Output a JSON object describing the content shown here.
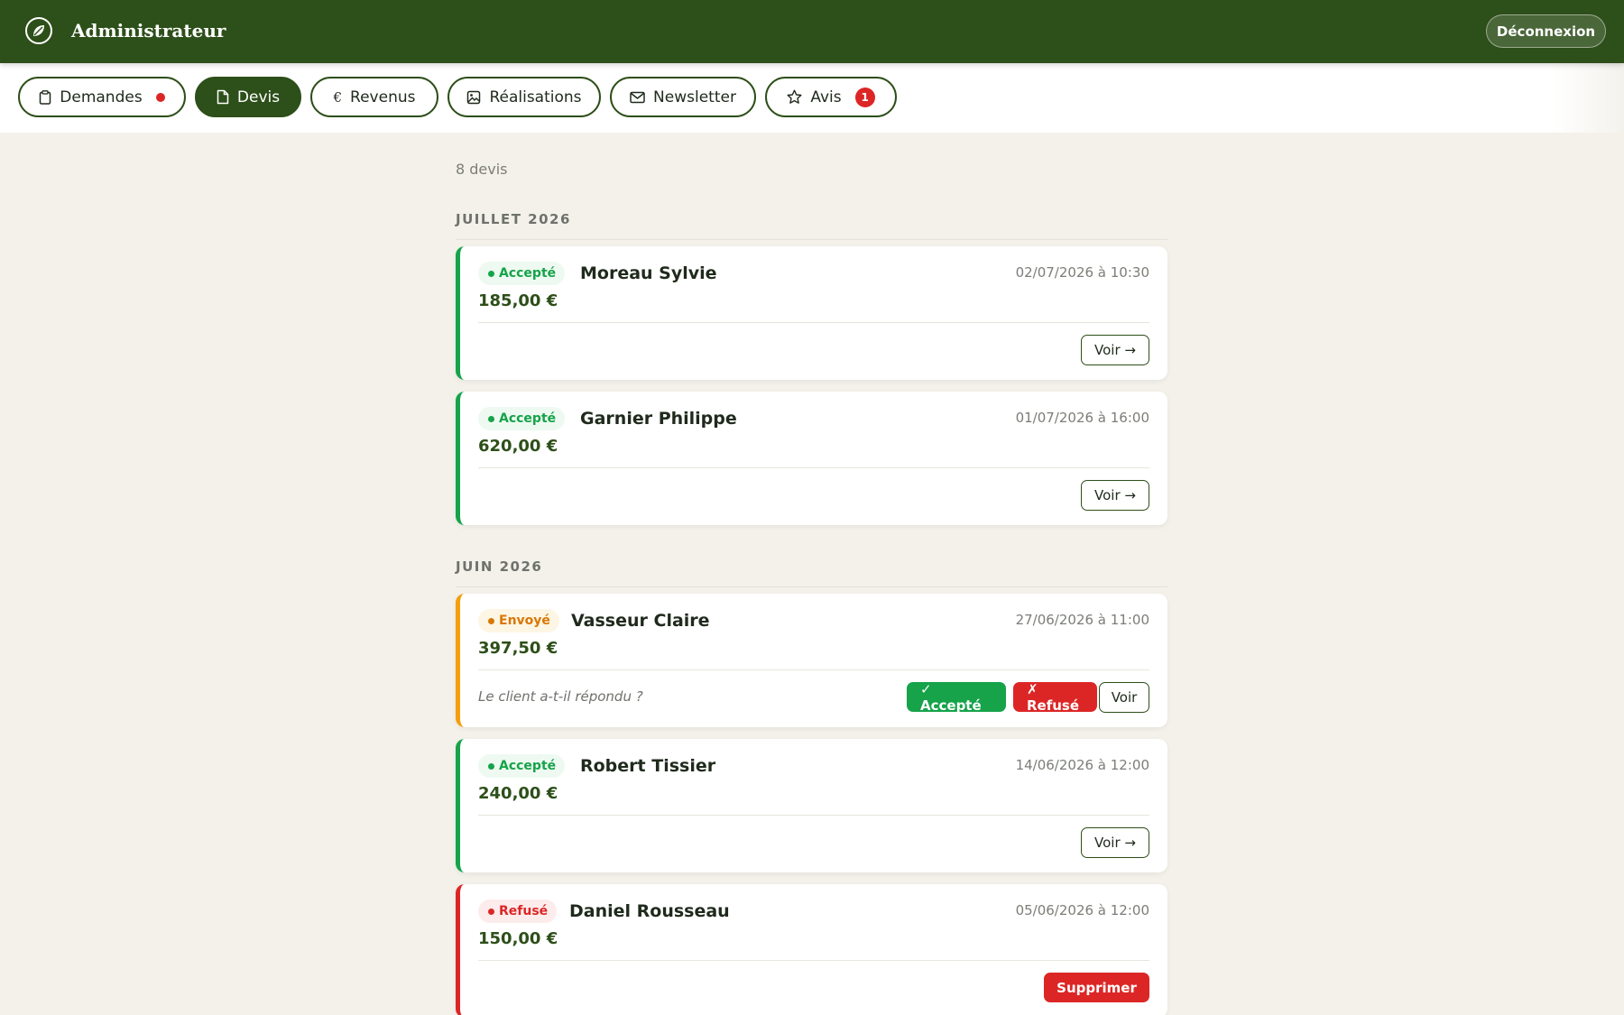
{
  "header": {
    "title": "Administrateur",
    "logout_label": "Déconnexion",
    "logo_icon": "leaf-icon"
  },
  "tabs": [
    {
      "label": "Demandes",
      "icon": "clipboard-icon",
      "has_dot": true,
      "active": false
    },
    {
      "label": "Devis",
      "icon": "document-icon",
      "active": true
    },
    {
      "label": "Revenus",
      "icon": "euro-icon",
      "active": false
    },
    {
      "label": "Réalisations",
      "icon": "image-icon",
      "active": false
    },
    {
      "label": "Newsletter",
      "icon": "mail-icon",
      "active": false
    },
    {
      "label": "Avis",
      "icon": "star-icon",
      "badge": "1",
      "active": false
    }
  ],
  "summary": {
    "count_text": "8 devis"
  },
  "groups": [
    {
      "month": "JUILLET 2026",
      "quotes": [
        {
          "status": "Accepté",
          "client": "Moreau Sylvie",
          "date": "02/07/2026 à 10:30",
          "amount": "185,00 €",
          "action": "Voir →"
        },
        {
          "status": "Accepté",
          "client": "Garnier Philippe",
          "date": "01/07/2026 à 16:00",
          "amount": "620,00 €",
          "action": "Voir →"
        }
      ]
    },
    {
      "month": "JUIN 2026",
      "quotes": [
        {
          "status": "Envoyé",
          "client": "Vasseur Claire",
          "date": "27/06/2026 à 11:00",
          "amount": "397,50 €",
          "question": "Le client a-t-il répondu ?",
          "accept_label": "✓ Accepté",
          "refuse_label": "✗ Refusé",
          "action": "Voir"
        },
        {
          "status": "Accepté",
          "client": "Robert Tissier",
          "date": "14/06/2026 à 12:00",
          "amount": "240,00 €",
          "action": "Voir →"
        },
        {
          "status": "Refusé",
          "client": "Daniel Rousseau",
          "date": "05/06/2026 à 12:00",
          "amount": "150,00 €",
          "action": "Supprimer"
        }
      ]
    }
  ],
  "colors": {
    "brand_green": "#2d4f19",
    "accepted": "#16a34a",
    "sent": "#f59e0b",
    "refused": "#dc2626",
    "background": "#f3f1ea"
  }
}
